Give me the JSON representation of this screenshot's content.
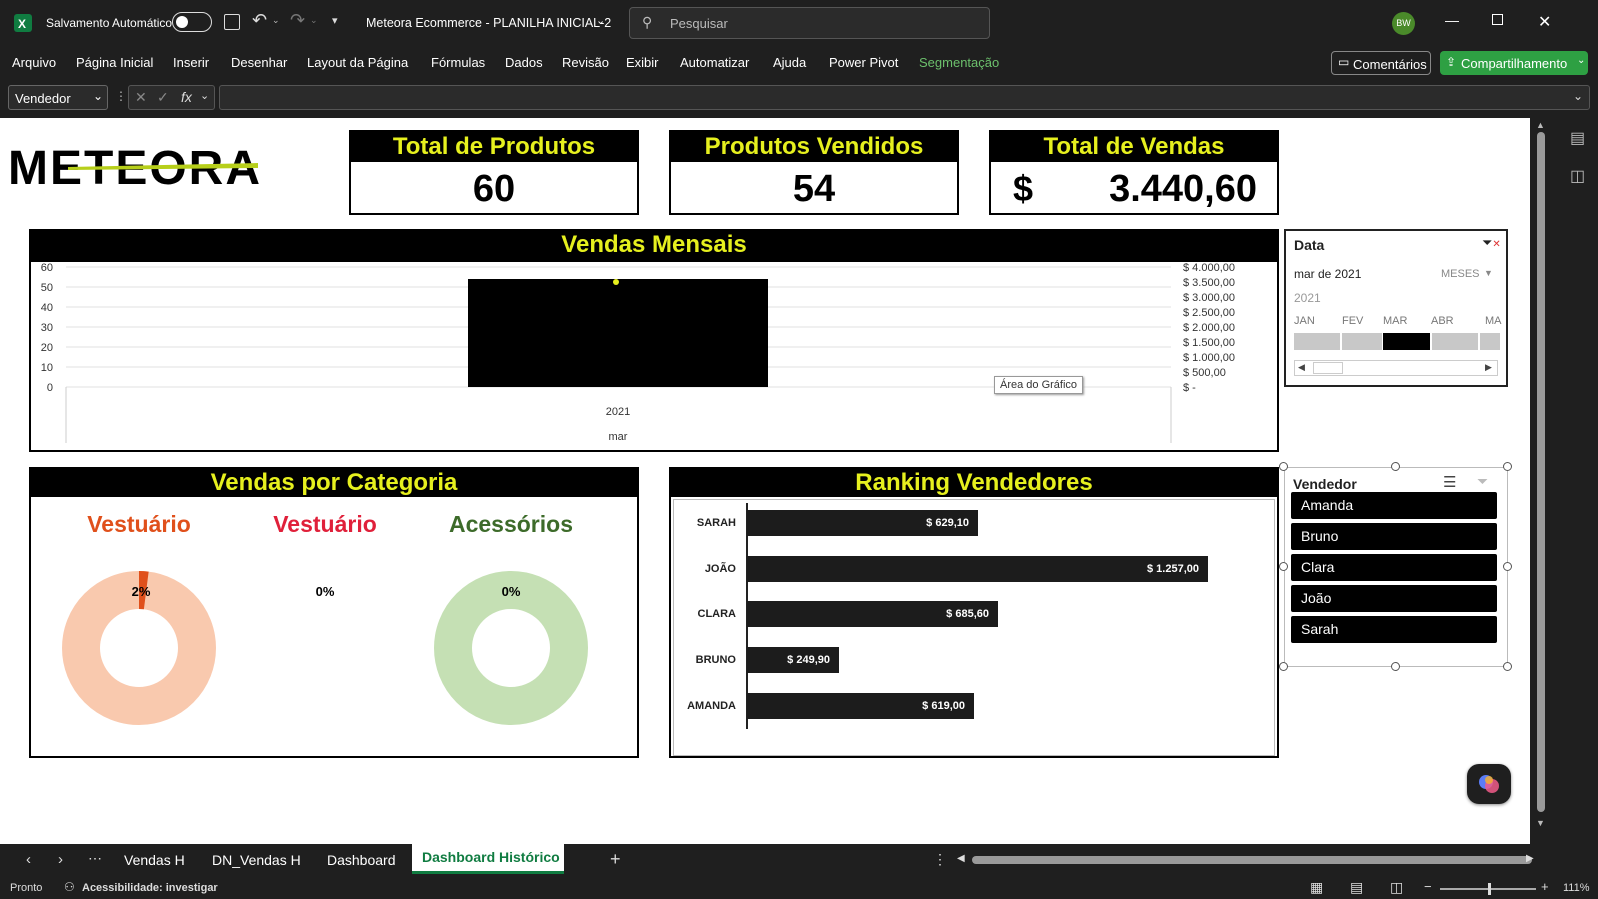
{
  "titlebar": {
    "autosave_label": "Salvamento Automático",
    "doc_title": "Meteora Ecommerce - PLANILHA INICIAL-2",
    "search_placeholder": "Pesquisar",
    "avatar_initials": "BW"
  },
  "ribbon": {
    "menu": [
      "Arquivo",
      "Página Inicial",
      "Inserir",
      "Desenhar",
      "Layout da Página",
      "Fórmulas",
      "Dados",
      "Revisão",
      "Exibir",
      "Automatizar",
      "Ajuda",
      "Power Pivot",
      "Segmentação"
    ],
    "comments_label": "Comentários",
    "share_label": "Compartilhamento"
  },
  "formula": {
    "name_box": "Vendedor",
    "fx": "fx"
  },
  "dashboard": {
    "logo_text": "METEORA",
    "kpis": [
      {
        "label": "Total de Produtos",
        "value": "60"
      },
      {
        "label": "Produtos Vendidos",
        "value": "54"
      },
      {
        "label": "Total de Vendas",
        "currency": "$",
        "value": "3.440,60"
      }
    ],
    "monthly": {
      "title": "Vendas Mensais",
      "left_ticks": [
        "60",
        "50",
        "40",
        "30",
        "20",
        "10",
        "0"
      ],
      "right_ticks": [
        "$ 4.000,00",
        "$ 3.500,00",
        "$ 3.000,00",
        "$ 2.500,00",
        "$ 2.000,00",
        "$ 1.500,00",
        "$ 1.000,00",
        "$ 500,00",
        "$ -"
      ],
      "x_year": "2021",
      "x_month": "mar",
      "tooltip": "Área do Gráfico"
    },
    "category": {
      "title": "Vendas por Categoria",
      "items": [
        {
          "label": "Vestuário",
          "percent": "2%",
          "color": "#e0501b"
        },
        {
          "label": "Vestuário",
          "percent": "0%",
          "color": "#e0203a"
        },
        {
          "label": "Acessórios",
          "percent": "0%",
          "color": "#3d6b2a"
        }
      ]
    },
    "ranking": {
      "title": "Ranking Vendedores"
    },
    "date_slicer": {
      "title": "Data",
      "selected": "mar de 2021",
      "level": "MESES",
      "year": "2021",
      "months": [
        "JAN",
        "FEV",
        "MAR",
        "ABR",
        "MA"
      ]
    },
    "seller_slicer": {
      "title": "Vendedor",
      "items": [
        "Amanda",
        "Bruno",
        "Clara",
        "João",
        "Sarah"
      ]
    }
  },
  "chart_data": [
    {
      "type": "bar",
      "title": "Vendas Mensais",
      "categories": [
        "2021 mar"
      ],
      "series": [
        {
          "values": [
            54
          ]
        }
      ],
      "ylim": [
        0,
        60
      ],
      "y2lim": [
        0,
        4000
      ],
      "grid": true
    },
    {
      "type": "pie",
      "title": "Vendas por Categoria",
      "categories": [
        "Vestuário",
        "Vestuário",
        "Acessórios"
      ],
      "values": [
        2,
        0,
        0
      ],
      "unit": "%"
    },
    {
      "type": "bar",
      "title": "Ranking Vendedores",
      "orientation": "horizontal",
      "categories": [
        "SARAH",
        "JOÃO",
        "CLARA",
        "BRUNO",
        "AMANDA"
      ],
      "values": [
        629.1,
        1257.0,
        685.6,
        249.9,
        619.0
      ],
      "labels": [
        "$ 629,10",
        "$ 1.257,00",
        "$ 685,60",
        "$ 249,90",
        "$ 619,00"
      ]
    }
  ],
  "tabs": {
    "sheets": [
      "Vendas H",
      "DN_Vendas H",
      "Dashboard",
      "Dashboard Histórico"
    ],
    "active": "Dashboard Histórico"
  },
  "status": {
    "ready": "Pronto",
    "accessibility": "Acessibilidade: investigar",
    "zoom": "111%"
  },
  "colors": {
    "accent": "#e6f01e",
    "excel_green": "#107c41",
    "share_green": "#2ea043"
  }
}
